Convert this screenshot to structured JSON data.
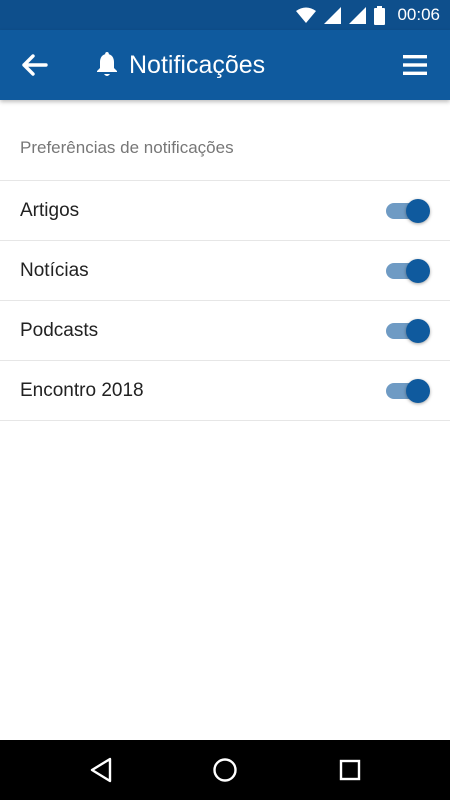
{
  "status_bar": {
    "time": "00:06",
    "icons": [
      "wifi-icon",
      "signal-icon",
      "signal-icon",
      "battery-icon"
    ]
  },
  "app_bar": {
    "title": "Notificações",
    "title_icon": "bell-icon",
    "back_icon": "arrow-left-icon",
    "menu_icon": "hamburger-menu-icon"
  },
  "section": {
    "header": "Preferências de notificações"
  },
  "preferences": [
    {
      "label": "Artigos",
      "enabled": true
    },
    {
      "label": "Notícias",
      "enabled": true
    },
    {
      "label": "Podcasts",
      "enabled": true
    },
    {
      "label": "Encontro 2018",
      "enabled": true
    }
  ],
  "nav_bar": {
    "icons": [
      "nav-back-icon",
      "nav-home-icon",
      "nav-recents-icon"
    ]
  },
  "colors": {
    "primary": "#0f5a9e",
    "status_bar": "#0e4f8c",
    "toggle_track": "#6f9bc4",
    "divider": "#e6e6e6"
  }
}
